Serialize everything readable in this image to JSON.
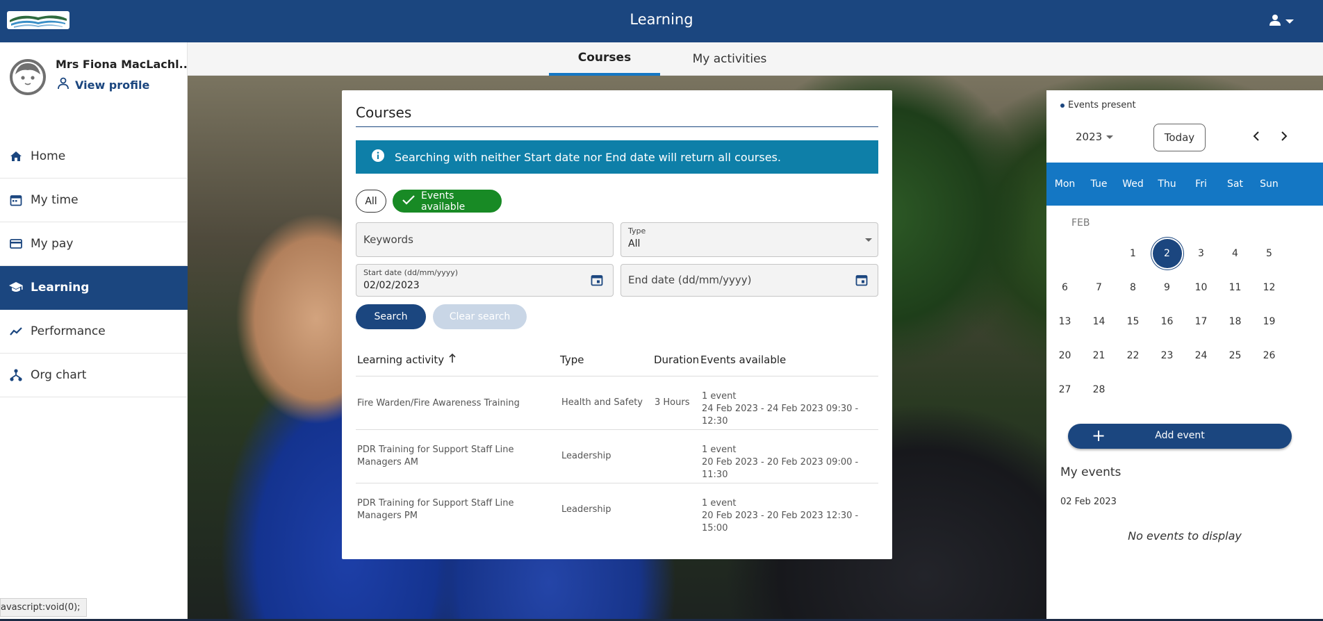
{
  "app": {
    "title": "Learning"
  },
  "user": {
    "name": "Mrs Fiona MacLachl...",
    "view_profile": "View profile"
  },
  "nav": [
    {
      "label": "Home",
      "icon": "home-icon"
    },
    {
      "label": "My time",
      "icon": "calendar-icon"
    },
    {
      "label": "My pay",
      "icon": "card-icon"
    },
    {
      "label": "Learning",
      "icon": "graduation-cap-icon",
      "active": true
    },
    {
      "label": "Performance",
      "icon": "trend-line-icon"
    },
    {
      "label": "Org chart",
      "icon": "org-chart-icon"
    }
  ],
  "tabs": [
    {
      "label": "Courses",
      "active": true
    },
    {
      "label": "My activities",
      "active": false
    }
  ],
  "courses": {
    "title": "Courses",
    "info": "Searching with neither Start date nor End date will return all courses.",
    "chips": {
      "all": "All",
      "events": "Events available"
    },
    "keywords_placeholder": "Keywords",
    "type_label": "Type",
    "type_value": "All",
    "start_label": "Start date (dd/mm/yyyy)",
    "start_value": "02/02/2023",
    "end_placeholder": "End date (dd/mm/yyyy)",
    "search_label": "Search",
    "clear_label": "Clear search",
    "columns": {
      "activity": "Learning activity",
      "type": "Type",
      "duration": "Duration",
      "events": "Events available"
    },
    "rows": [
      {
        "activity": "Fire Warden/Fire Awareness Training",
        "type": "Health and Safety",
        "duration": "3 Hours",
        "events_count": "1 event",
        "events_range": "24 Feb 2023 - 24 Feb 2023 09:30 - 12:30"
      },
      {
        "activity": "PDR Training for Support Staff Line Managers AM",
        "type": "Leadership",
        "duration": "",
        "events_count": "1 event",
        "events_range": "20 Feb 2023 - 20 Feb 2023 09:00 - 11:30"
      },
      {
        "activity": "PDR Training for Support Staff Line Managers PM",
        "type": "Leadership",
        "duration": "",
        "events_count": "1 event",
        "events_range": "20 Feb 2023 - 20 Feb 2023 12:30 - 15:00"
      }
    ]
  },
  "calendar": {
    "legend": "Events present",
    "year": "2023",
    "today_label": "Today",
    "weekdays": [
      "Mon",
      "Tue",
      "Wed",
      "Thu",
      "Fri",
      "Sat",
      "Sun"
    ],
    "month_label": "FEB",
    "first_weekday_index": 2,
    "days_in_month": 28,
    "selected_day": 2,
    "add_event_label": "Add event",
    "my_events_title": "My events",
    "my_events_date": "02 Feb 2023",
    "no_events": "No events to display"
  },
  "status_url": "avascript:void(0);",
  "colors": {
    "primary": "#1b467f",
    "accent": "#1477c4",
    "info": "#0e7fa8",
    "success": "#188a25"
  }
}
